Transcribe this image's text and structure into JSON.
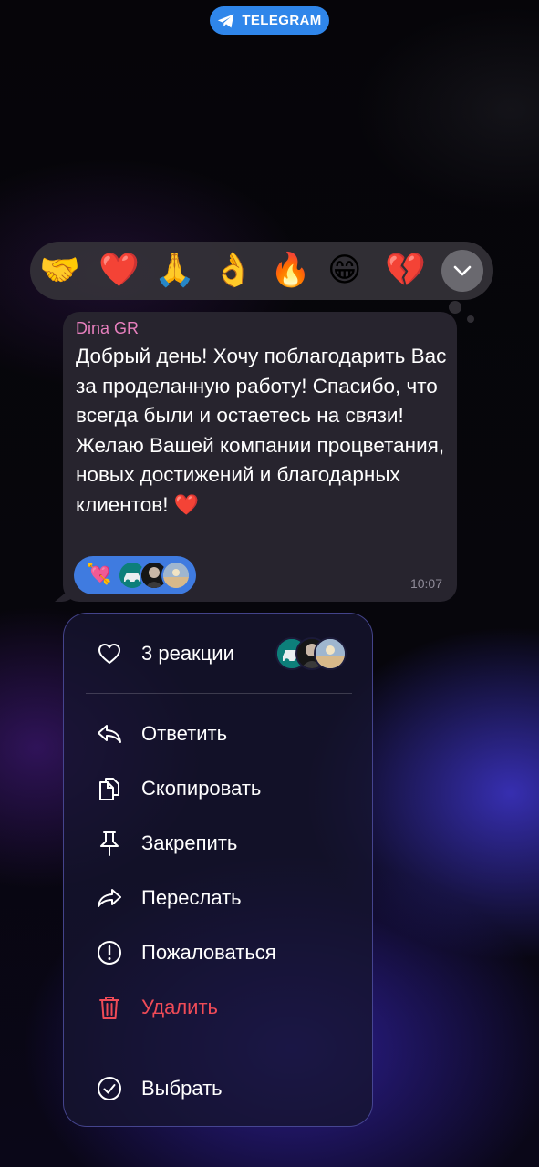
{
  "badge": {
    "label": "TELEGRAM"
  },
  "reactions_bar": {
    "emojis": [
      "🤝",
      "❤️",
      "🙏",
      "👌",
      "🔥",
      "😁",
      "💔"
    ]
  },
  "message": {
    "sender": "Dina GR",
    "text": "Добрый день! Хочу поблагодарить Вас за проделанную работу! Спасибо, что всегда были и остаетесь на связи! Желаю Вашей компании процветания, новых достижений и благодарных клиентов! ",
    "heart": "❤️",
    "reaction_emoji": "💘",
    "time": "10:07"
  },
  "menu": {
    "reactions_label": "3 реакции",
    "items": [
      {
        "label": "Ответить",
        "icon": "reply-icon"
      },
      {
        "label": "Скопировать",
        "icon": "copy-icon"
      },
      {
        "label": "Закрепить",
        "icon": "pin-icon"
      },
      {
        "label": "Переслать",
        "icon": "forward-icon"
      },
      {
        "label": "Пожаловаться",
        "icon": "report-icon"
      },
      {
        "label": "Удалить",
        "icon": "trash-icon"
      }
    ],
    "select_label": "Выбрать"
  },
  "colors": {
    "badge": "#2f86ea",
    "sender": "#e67fbd",
    "reaction_pill": "#3f7be0",
    "danger": "#ef4b57"
  }
}
